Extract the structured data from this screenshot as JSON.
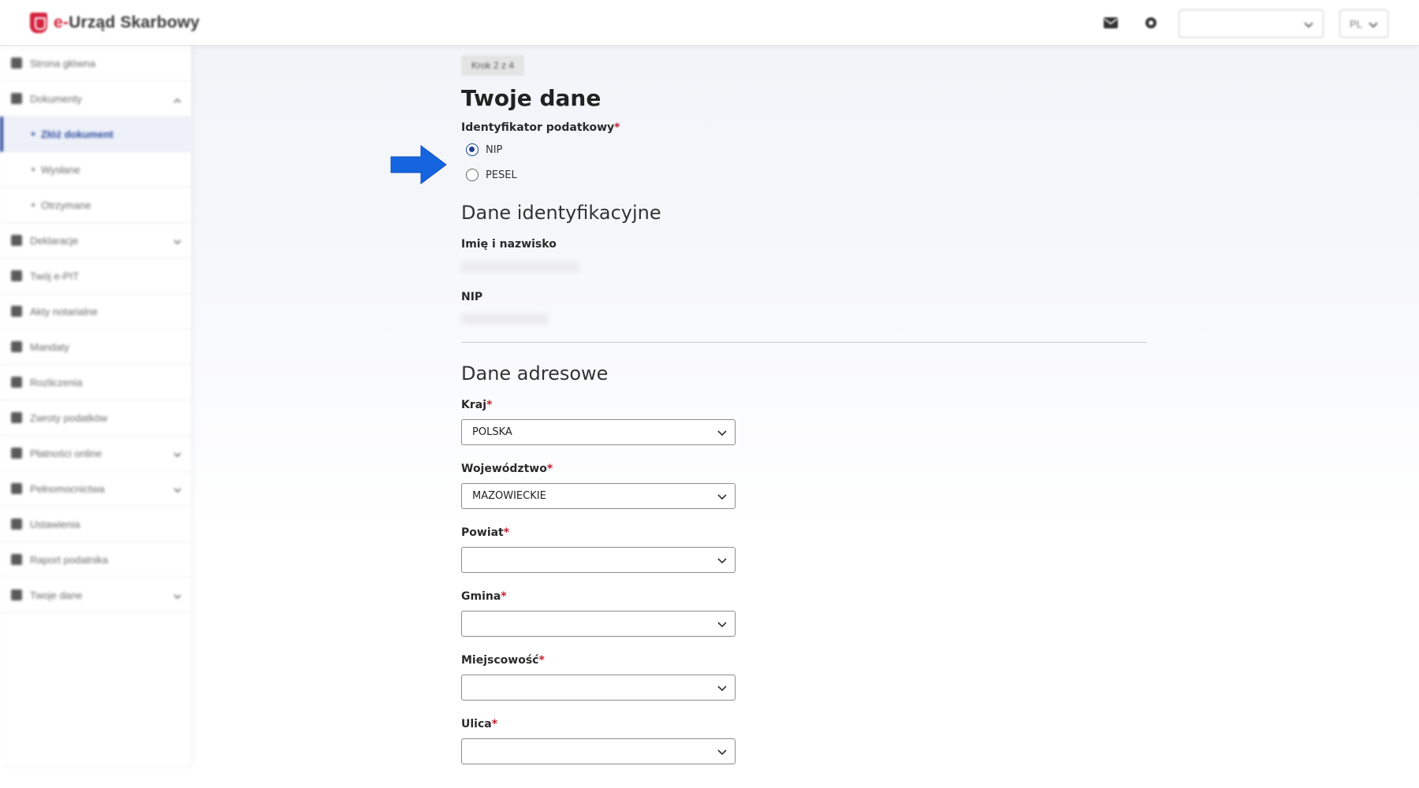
{
  "header": {
    "brand_prefix": "e-",
    "brand_name": "Urząd Skarbowy",
    "language": "PL",
    "icons": [
      "envelope-icon",
      "gear-icon"
    ],
    "brand_color": "#d4213d"
  },
  "sidebar": {
    "items": [
      {
        "label": "Strona główna",
        "icon": "home-icon"
      },
      {
        "label": "Dokumenty",
        "icon": "document-icon"
      },
      {
        "label": "Złóż dokument",
        "sub": true,
        "active": true
      },
      {
        "label": "Wysłane",
        "sub": true
      },
      {
        "label": "Otrzymane",
        "sub": true
      },
      {
        "label": "Deklaracje",
        "icon": "document-icon"
      },
      {
        "label": "Twój e-PIT",
        "icon": "document-icon"
      },
      {
        "label": "Akty notarialne",
        "icon": "notary-icon"
      },
      {
        "label": "Mandaty",
        "icon": "ticket-icon"
      },
      {
        "label": "Rozliczenia",
        "icon": "wallet-icon"
      },
      {
        "label": "Zwroty podatków",
        "icon": "refund-icon"
      },
      {
        "label": "Płatności online",
        "icon": "card-icon"
      },
      {
        "label": "Pełnomocnictwa",
        "icon": "users-icon"
      },
      {
        "label": "Ustawienia",
        "icon": "gear-icon"
      },
      {
        "label": "Raport podatnika",
        "icon": "report-icon"
      },
      {
        "label": "Twoje dane",
        "icon": "user-icon"
      }
    ]
  },
  "form": {
    "step": "Krok 2 z 4",
    "title": "Twoje dane",
    "tax_id": {
      "label": "Identyfikator podatkowy",
      "required_mark": "*",
      "options": [
        {
          "label": "NIP",
          "checked": true
        },
        {
          "label": "PESEL",
          "checked": false
        }
      ]
    },
    "identification": {
      "section_title": "Dane identyfikacyjne",
      "name_label": "Imię i nazwisko",
      "nip_label": "NIP"
    },
    "address": {
      "section_title": "Dane adresowe",
      "fields": [
        {
          "label": "Kraj",
          "value": "POLSKA"
        },
        {
          "label": "Województwo",
          "value": "MAZOWIECKIE"
        },
        {
          "label": "Powiat",
          "value": ""
        },
        {
          "label": "Gmina",
          "value": ""
        },
        {
          "label": "Miejscowość",
          "value": ""
        },
        {
          "label": "Ulica",
          "value": ""
        }
      ],
      "required_mark": "*"
    }
  },
  "colors": {
    "primary": "#1e3f91",
    "required": "#c41c2b",
    "annotation_arrow": "#1565e0"
  }
}
